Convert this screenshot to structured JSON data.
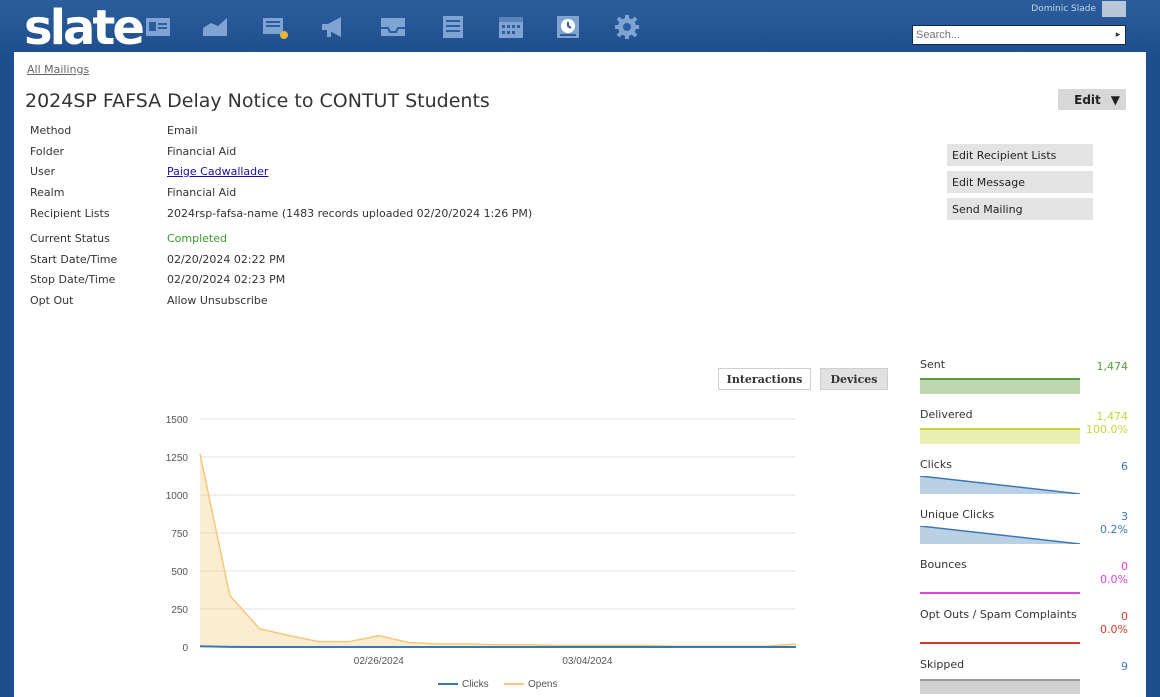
{
  "app": {
    "logo_text": "slate",
    "user_name": "Dominic Slade",
    "search": {
      "placeholder": "Search...",
      "value": ""
    },
    "nav_icons": [
      "id-card-icon",
      "chart-icon",
      "reader-icon",
      "megaphone-icon",
      "inbox-icon",
      "forms-icon",
      "calendar-icon",
      "clock-icon",
      "gear-icon"
    ]
  },
  "breadcrumb": "All Mailings",
  "page_title": "2024SP FAFSA Delay Notice to CONTUT Students",
  "edit_button": {
    "label": "Edit",
    "arrow": "▼"
  },
  "fields": [
    {
      "label": "Method",
      "value": "Email"
    },
    {
      "label": "Folder",
      "value": "Financial Aid"
    },
    {
      "label": "User",
      "value": "Paige Cadwallader"
    },
    {
      "label": "Realm",
      "value": "Financial Aid"
    },
    {
      "label": "Recipient Lists",
      "value": "2024rsp-fafsa-name (1483 records uploaded 02/20/2024 1:26 PM)"
    },
    {
      "label": "Current Status",
      "value": "Completed"
    },
    {
      "label": "Start Date/Time",
      "value": "02/20/2024 02:22 PM"
    },
    {
      "label": "Stop Date/Time",
      "value": "02/20/2024 02:23 PM"
    },
    {
      "label": "Opt Out",
      "value": "Allow Unsubscribe"
    }
  ],
  "side_actions": [
    "Edit Recipient Lists",
    "Edit Message",
    "Send Mailing"
  ],
  "tabs": {
    "interactions": "Interactions",
    "devices": "Devices"
  },
  "stats": [
    {
      "label": "Sent",
      "value": "1,474",
      "pct": "",
      "color": "#5a9e3a"
    },
    {
      "label": "Delivered",
      "value": "1,474",
      "pct": "100.0%",
      "color": "#c5d63a"
    },
    {
      "label": "Clicks",
      "value": "6",
      "pct": "",
      "color": "#3a78b5"
    },
    {
      "label": "Unique Clicks",
      "value": "3",
      "pct": "0.2%",
      "color": "#3a78b5"
    },
    {
      "label": "Bounces",
      "value": "0",
      "pct": "0.0%",
      "color": "#e040e0"
    },
    {
      "label": "Opt Outs / Spam Complaints",
      "value": "0",
      "pct": "0.0%",
      "color": "#d63a2a"
    },
    {
      "label": "Skipped",
      "value": "9",
      "pct": "",
      "color": "#3a78b5"
    }
  ],
  "chart_data": {
    "type": "area",
    "title": "",
    "xlabel": "",
    "ylabel": "",
    "ylim": [
      0,
      1500
    ],
    "yticks": [
      0,
      250,
      500,
      750,
      1000,
      1250,
      1500
    ],
    "xtick_labels": [
      "02/26/2024",
      "03/04/2024"
    ],
    "xtick_index": [
      6,
      13
    ],
    "x": [
      "02/20/2024",
      "02/21/2024",
      "02/22/2024",
      "02/23/2024",
      "02/24/2024",
      "02/25/2024",
      "02/26/2024",
      "02/27/2024",
      "02/28/2024",
      "02/29/2024",
      "03/01/2024",
      "03/02/2024",
      "03/03/2024",
      "03/04/2024",
      "03/05/2024",
      "03/06/2024",
      "03/07/2024",
      "03/08/2024",
      "03/09/2024",
      "03/10/2024",
      "03/11/2024"
    ],
    "series": [
      {
        "name": "Clicks",
        "color": "#3a78b5",
        "values": [
          5,
          1,
          0,
          0,
          0,
          0,
          0,
          0,
          0,
          0,
          0,
          0,
          0,
          0,
          0,
          0,
          0,
          0,
          0,
          0,
          0
        ]
      },
      {
        "name": "Opens",
        "color": "#f5c878",
        "values": [
          1270,
          340,
          120,
          75,
          35,
          35,
          75,
          30,
          20,
          20,
          15,
          15,
          10,
          10,
          10,
          10,
          5,
          5,
          5,
          5,
          20
        ]
      }
    ],
    "legend": "bottom",
    "grid": true
  }
}
